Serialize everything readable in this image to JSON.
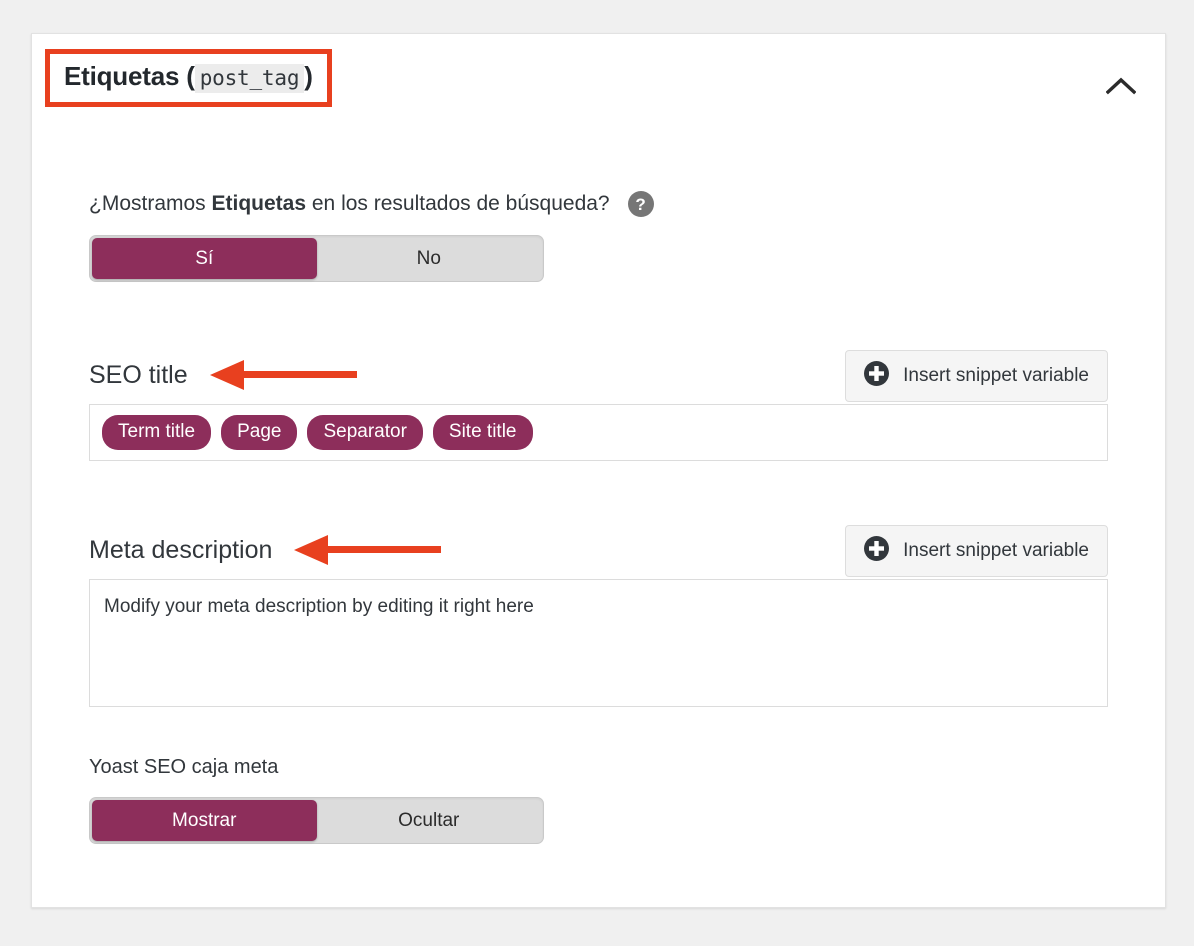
{
  "colors": {
    "page_background": "#f0f0f0",
    "card_background": "#ffffff",
    "accent_purple": "#8d2e5b",
    "annotation_red": "#e8401f",
    "toggle_inactive": "#dcdcdc",
    "help_icon_gray": "#767676"
  },
  "header": {
    "title_main": "Etiquetas (",
    "title_code": "post_tag",
    "title_close": ")",
    "collapse_icon": "chevron-up-icon"
  },
  "visibility_question": {
    "text_before": "¿Mostramos ",
    "text_bold": "Etiquetas",
    "text_after": " en los resultados de búsqueda?",
    "help_icon": "help-circle-icon",
    "help_icon_glyph": "?",
    "toggle": {
      "options": [
        "Sí",
        "No"
      ],
      "selected": "Sí"
    }
  },
  "seo_title": {
    "label": "SEO title",
    "annotation": "left-arrow-annotation",
    "snippet_button": {
      "label": "Insert snippet variable",
      "icon": "plus-circle-icon"
    },
    "tags": [
      "Term title",
      "Page",
      "Separator",
      "Site title"
    ]
  },
  "meta_description": {
    "label": "Meta description",
    "annotation": "left-arrow-annotation",
    "snippet_button": {
      "label": "Insert snippet variable",
      "icon": "plus-circle-icon"
    },
    "value": "Modify your meta description by editing it right here",
    "placeholder": "Modify your meta description by editing it right here"
  },
  "metabox_section": {
    "label": "Yoast SEO caja meta",
    "toggle": {
      "options": [
        "Mostrar",
        "Ocultar"
      ],
      "selected": "Mostrar"
    }
  }
}
